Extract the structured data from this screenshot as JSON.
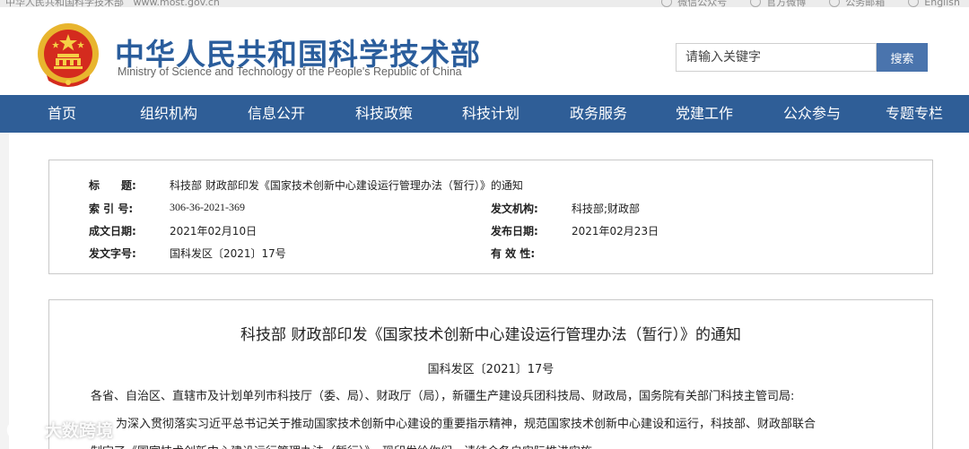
{
  "topbar": {
    "left_text": "中华人民共和国科学技术部",
    "domain": "www.most.gov.cn",
    "links": [
      "微信公众号",
      "官方微博",
      "公务邮箱",
      "English"
    ]
  },
  "header": {
    "title": "中华人民共和国科学技术部",
    "subtitle": "Ministry of Science and Technology of the People's Republic of China",
    "search_placeholder": "请输入关键字",
    "search_button": "搜索"
  },
  "nav": {
    "items": [
      "首页",
      "组织机构",
      "信息公开",
      "科技政策",
      "科技计划",
      "政务服务",
      "党建工作",
      "公众参与",
      "专题专栏"
    ]
  },
  "meta": {
    "title_label": "标　　题:",
    "title_value": "科技部 财政部印发《国家技术创新中心建设运行管理办法（暂行）》的通知",
    "index_label": "索 引 号:",
    "index_value": "306-36-2021-369",
    "issuer_label": "发文机构:",
    "issuer_value": "科技部;财政部",
    "created_label": "成文日期:",
    "created_value": "2021年02月10日",
    "published_label": "发布日期:",
    "published_value": "2021年02月23日",
    "docno_label": "发文字号:",
    "docno_value": "国科发区〔2021〕17号",
    "validity_label": "有 效 性:",
    "validity_value": ""
  },
  "doc": {
    "title": "科技部 财政部印发《国家技术创新中心建设运行管理办法（暂行）》的通知",
    "number": "国科发区〔2021〕17号",
    "recipients": "各省、自治区、直辖市及计划单列市科技厅（委、局）、财政厅（局），新疆生产建设兵团科技局、财政局，国务院有关部门科技主管司局:",
    "para1": "为深入贯彻落实习近平总书记关于推动国家技术创新中心建设的重要指示精神，规范国家技术创新中心建设和运行，科技部、财政部联合",
    "para2": "制定了《国家技术创新中心建设运行管理办法（暂行）》，现印发给你们，请结合各自实际推进实施。"
  },
  "watermark": {
    "text": "大数跨境"
  },
  "colors": {
    "brand_blue": "#2f5e97",
    "title_blue": "#2a5d9c",
    "button_blue": "#4a74ad",
    "emblem_red": "#d42b1e",
    "emblem_gold": "#e8b52e"
  }
}
